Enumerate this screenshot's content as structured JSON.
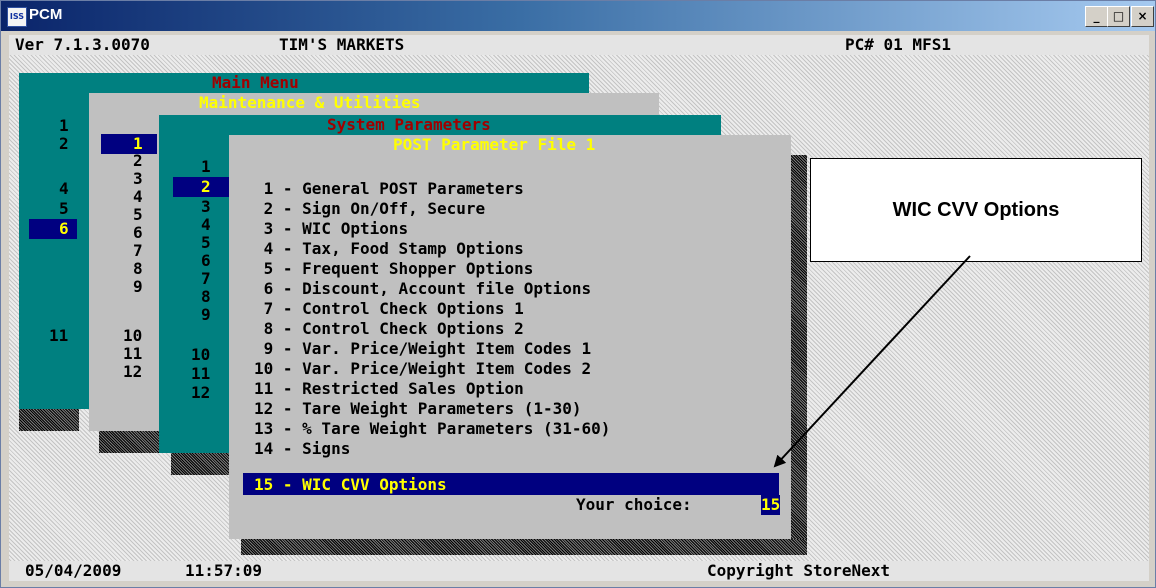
{
  "window": {
    "title": "PCM",
    "icon_text": "ISS",
    "buttons": [
      "_",
      "□",
      "×"
    ]
  },
  "header": {
    "version": "Ver 7.1.3.0070",
    "store": "TIM'S MARKETS",
    "pc": "PC# 01 MFS1"
  },
  "main_menu": {
    "title": "Main Menu",
    "numbers": [
      "1",
      "2",
      "4",
      "5",
      "6",
      "11"
    ],
    "selected": "6"
  },
  "maintenance": {
    "title": "Maintenance & Utilities",
    "numbers": [
      "1",
      "2",
      "3",
      "4",
      "5",
      "6",
      "7",
      "8",
      "9",
      "10",
      "11",
      "12"
    ],
    "selected": "1"
  },
  "system_params": {
    "title": "System Parameters",
    "numbers": [
      "1",
      "2",
      "3",
      "4",
      "5",
      "6",
      "7",
      "8",
      "9",
      "10",
      "11",
      "12"
    ],
    "selected": "2"
  },
  "post_params": {
    "title": "POST Parameter File 1",
    "items": [
      " 1 - General POST Parameters",
      " 2 - Sign On/Off, Secure",
      " 3 - WIC Options",
      " 4 - Tax, Food Stamp Options",
      " 5 - Frequent Shopper Options",
      " 6 - Discount, Account file Options",
      " 7 - Control Check Options 1",
      " 8 - Control Check Options 2",
      " 9 - Var. Price/Weight Item Codes 1",
      "10 - Var. Price/Weight Item Codes 2",
      "11 - Restricted Sales Option",
      "12 - Tare Weight Parameters (1-30)",
      "13 - % Tare Weight Parameters (31-60)",
      "14 - Signs",
      "15 - WIC CVV Options"
    ],
    "selected_index": 14,
    "choice_label": "Your choice: ",
    "choice_value": "15"
  },
  "status": {
    "date": "05/04/2009",
    "time": "11:57:09",
    "copyright": "Copyright StoreNext"
  },
  "callout": {
    "label": "WIC CVV Options"
  },
  "colors": {
    "teal": "#008080",
    "gray": "#c0c0c0",
    "navy": "#000080",
    "red": "#a00000",
    "yellow": "#ffff00"
  }
}
